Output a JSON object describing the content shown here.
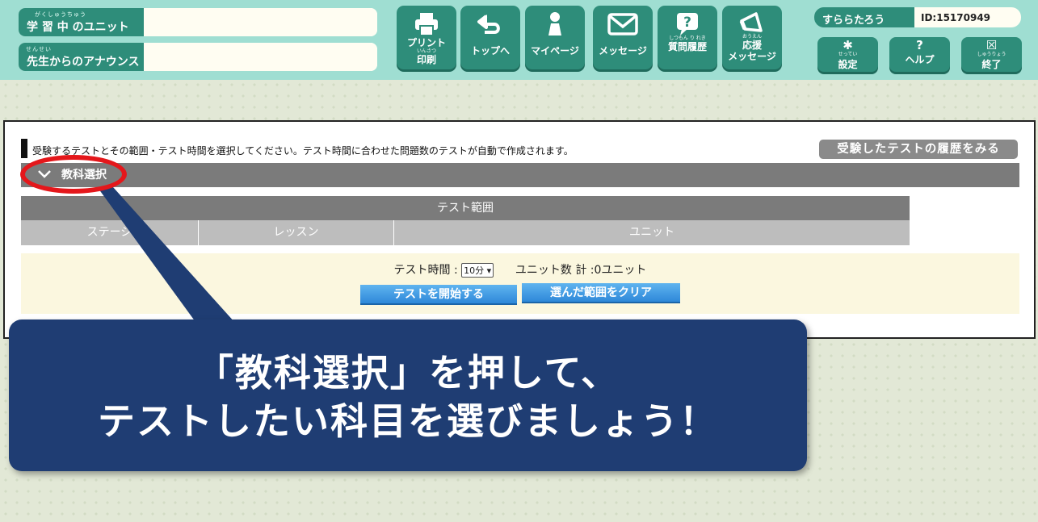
{
  "header": {
    "current_unit": {
      "ruby": "がくしゅうちゅう",
      "label": "学 習 中 のユニット",
      "value": ""
    },
    "announce": {
      "ruby": "せんせい",
      "label": "先生からのアナウンス",
      "value": ""
    },
    "nav": [
      {
        "label": "プリント",
        "ruby": "いんさつ",
        "label2": "印刷",
        "icon": "printer-icon"
      },
      {
        "label": "トップへ",
        "icon": "return-arrow-icon"
      },
      {
        "label": "マイページ",
        "icon": "person-icon"
      },
      {
        "label": "メッセージ",
        "icon": "envelope-icon"
      },
      {
        "ruby": "しつもん り れき",
        "label": "質問履歴",
        "icon": "question-bubble-icon"
      },
      {
        "ruby": "おうえん",
        "label": "応援",
        "label2": "メッセージ",
        "icon": "megaphone-icon"
      }
    ],
    "user": {
      "name": "すららたろう",
      "id": "ID:15170949"
    },
    "utility": [
      {
        "ruby": "せってい",
        "label": "設定",
        "icon": "gear-icon",
        "glyph": "✱"
      },
      {
        "label": "ヘルプ",
        "icon": "question-icon",
        "glyph": "?"
      },
      {
        "ruby": "しゅうりょう",
        "label": "終了",
        "icon": "close-icon",
        "glyph": "☒"
      }
    ]
  },
  "panel": {
    "instruction": "受験するテストとその範囲・テスト時間を選択してください。テスト時間に合わせた問題数のテストが自動で作成されます。",
    "history_button": "受験したテストの履歴をみる",
    "subject_toggle": "教科選択",
    "range_title": "テスト範囲",
    "columns": [
      "ステージ",
      "レッスン",
      "ユニット"
    ],
    "time_label": "テスト時間 :",
    "time_value": "10分",
    "unit_count": "ユニット数 計 :0ユニット",
    "start_button": "テストを開始する",
    "clear_button": "選んだ範囲をクリア"
  },
  "callout": {
    "line1": "「教科選択」を押して、",
    "line2": "テストしたい科目を選びましょう！"
  },
  "colors": {
    "header_bg": "#9fded2",
    "brand_green": "#2e8d7a",
    "highlight_red": "#e4171b",
    "callout_navy": "#1f3d73",
    "button_blue": "#2e88d9"
  }
}
